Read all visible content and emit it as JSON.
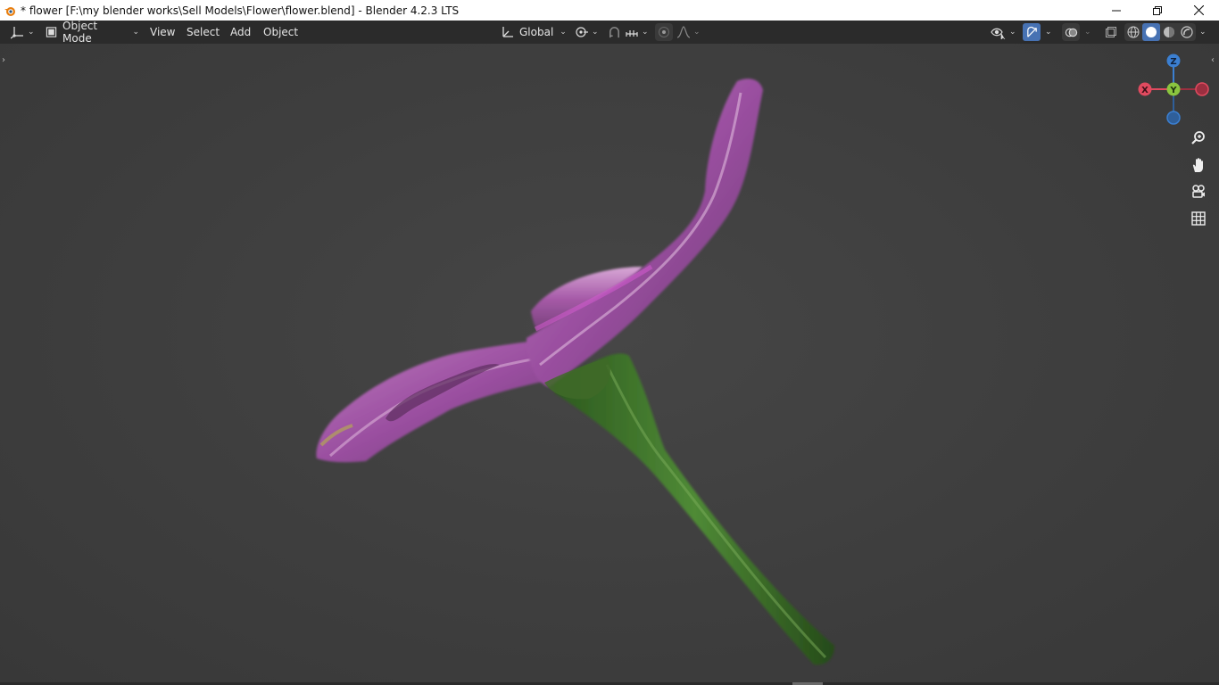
{
  "window": {
    "title": "* flower [F:\\my blender works\\Sell Models\\Flower\\flower.blend] - Blender 4.2.3 LTS",
    "app_icon": "blender-logo-icon",
    "controls": [
      "minimize-icon",
      "restore-icon",
      "close-icon"
    ]
  },
  "header": {
    "editor_type_icon": "3d-viewport-icon",
    "mode_label": "Object Mode",
    "menus": {
      "view": "View",
      "select": "Select",
      "add": "Add",
      "object": "Object"
    },
    "transform_orientation": "Global",
    "icons": {
      "orientation": "transform-orientation-icon",
      "pivot": "pivot-point-icon",
      "snap": "magnet-snap-icon",
      "snap_target": "snap-increment-icon",
      "proportional": "proportional-edit-icon",
      "falloff": "falloff-curve-icon",
      "visibility": "eye-selectability-icon",
      "gizmo": "gizmo-toggle-icon",
      "overlays": "overlays-icon",
      "xray": "xray-toggle-icon",
      "wireframe": "wireframe-shading-icon",
      "solid": "solid-shading-icon",
      "material": "material-preview-icon",
      "rendered": "rendered-shading-icon"
    }
  },
  "navigation_gizmo": {
    "axes": {
      "z": "Z",
      "y": "Y",
      "x": "X"
    },
    "colors": {
      "x": "#e04a5f",
      "y": "#8bc53f",
      "z": "#3b7fd1",
      "neg_x": "#9b2f40",
      "neg_z": "#2f5f9a"
    }
  },
  "nav_buttons": {
    "zoom": "zoom-magnifier-icon",
    "pan": "hand-pan-icon",
    "camera": "camera-view-icon",
    "ortho": "orthographic-grid-icon"
  },
  "viewport": {
    "background": "#3d3d3d",
    "object": "flower-model"
  },
  "colors": {
    "header_bg": "#2b2b2b",
    "active_blue": "#4772b3",
    "petal": "#9b4fa3",
    "stem": "#3e7a2c"
  }
}
